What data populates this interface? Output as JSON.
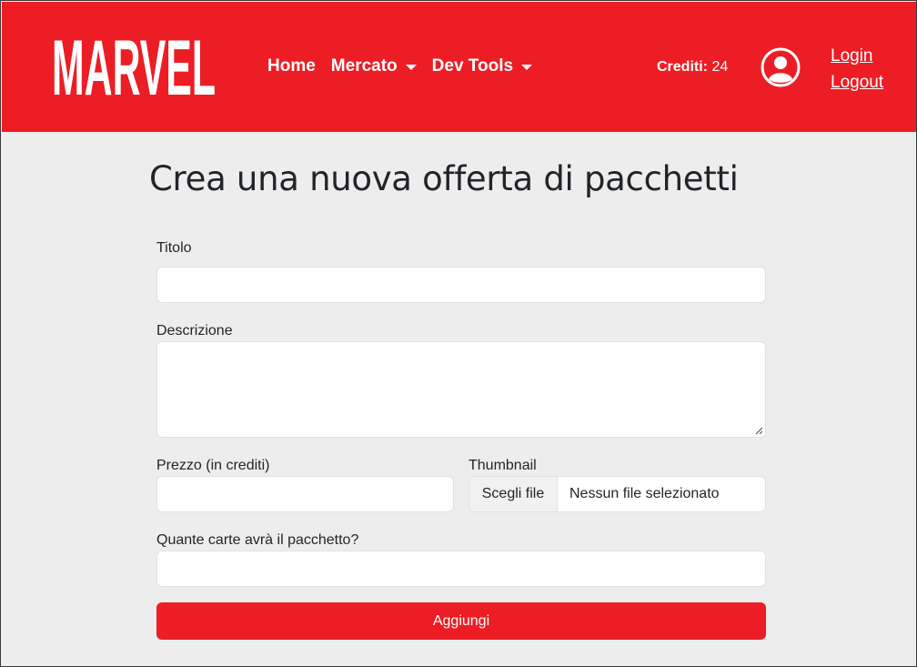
{
  "brand": {
    "logo_text": "MARVEL",
    "color": "#ec1d24"
  },
  "nav": {
    "home": "Home",
    "market": "Mercato",
    "dev_tools": "Dev Tools"
  },
  "credits": {
    "label": "Crediti:",
    "value": "24"
  },
  "auth": {
    "login": "Login",
    "logout": "Logout"
  },
  "form": {
    "title": "Crea una nuova offerta di pacchetti",
    "fields": {
      "title_label": "Titolo",
      "title_value": "",
      "description_label": "Descrizione",
      "description_value": "",
      "price_label": "Prezzo (in crediti)",
      "price_value": "",
      "thumbnail_label": "Thumbnail",
      "file_button": "Scegli file",
      "file_status": "Nessun file selezionato",
      "cards_label": "Quante carte avrà il pacchetto?",
      "cards_value": ""
    },
    "submit": "Aggiungi"
  },
  "icons": {
    "avatar": "user-circle-icon",
    "caret": "caret-down-icon"
  }
}
